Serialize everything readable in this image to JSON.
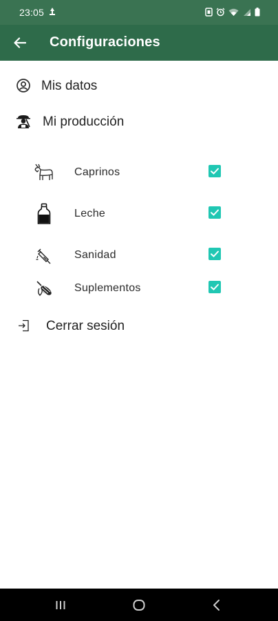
{
  "status_bar": {
    "time": "23:05",
    "icons": [
      "notification-icon",
      "battery-saver-icon",
      "alarm-icon",
      "wifi-icon",
      "signal-icon",
      "battery-icon"
    ]
  },
  "app_bar": {
    "title": "Configuraciones",
    "back_icon": "arrow-left-icon"
  },
  "menu": {
    "mis_datos": {
      "label": "Mis datos",
      "icon": "account-circle-icon"
    },
    "mi_produccion": {
      "label": "Mi producción",
      "icon": "farmer-icon"
    },
    "cerrar_sesion": {
      "label": "Cerrar sesión",
      "icon": "logout-icon"
    }
  },
  "production_items": [
    {
      "label": "Caprinos",
      "icon": "goat-icon",
      "checked": true
    },
    {
      "label": "Leche",
      "icon": "milk-bottle-icon",
      "checked": true
    },
    {
      "label": "Sanidad",
      "icon": "syringe-icon",
      "checked": true
    },
    {
      "label": "Suplementos",
      "icon": "corn-icon",
      "checked": true
    }
  ],
  "colors": {
    "app_bar": "#2e6b4a",
    "status_bar": "#3a7352",
    "checkbox": "#20c7b3",
    "nav_bar": "#000000"
  },
  "nav_bar": {
    "buttons": [
      "recent-apps-icon",
      "home-icon",
      "back-icon"
    ]
  }
}
